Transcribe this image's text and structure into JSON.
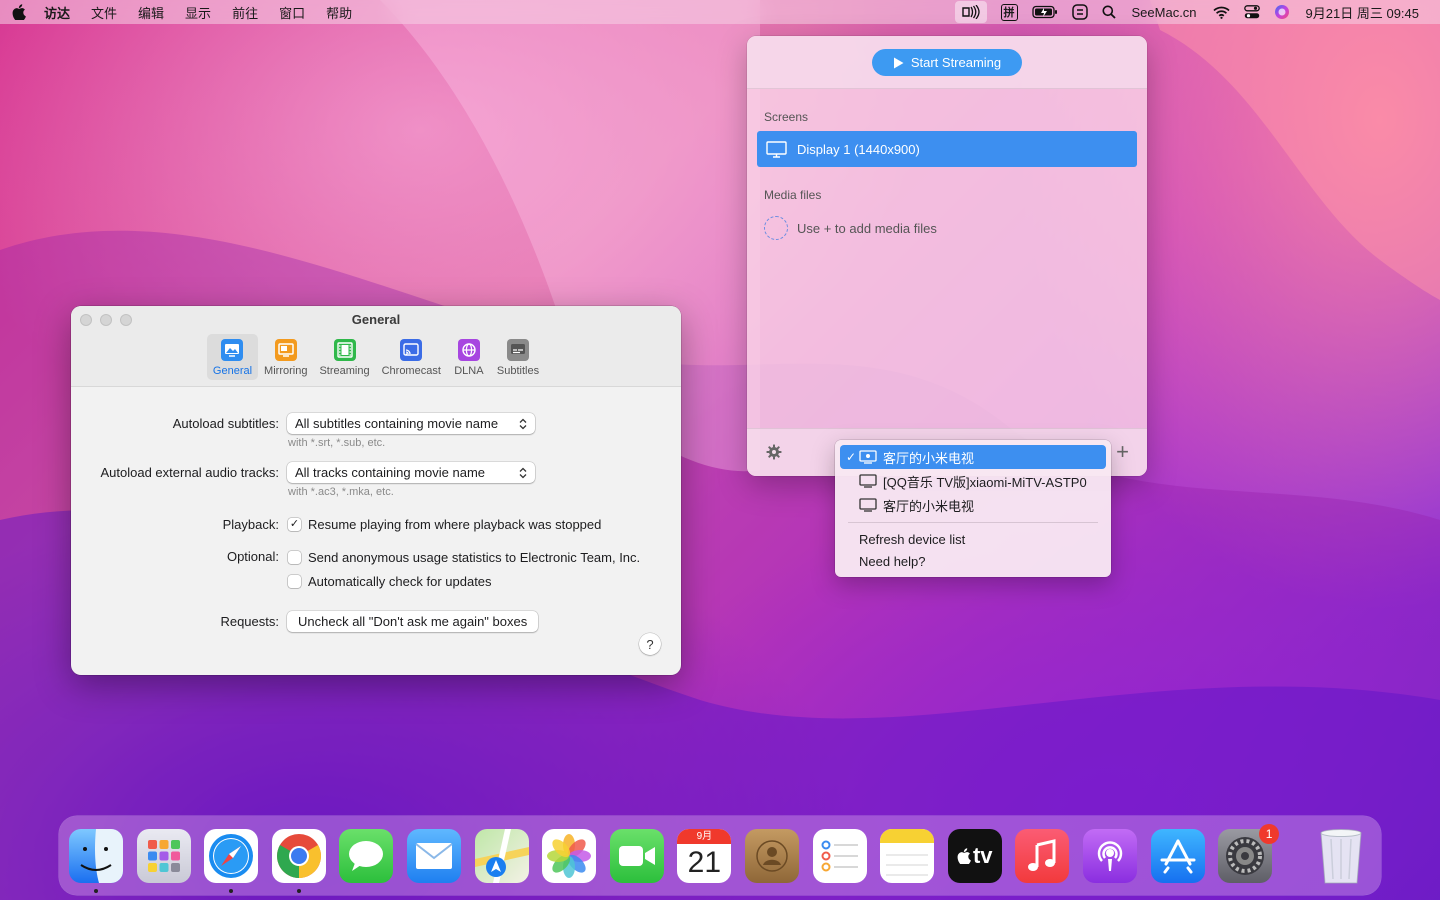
{
  "menubar": {
    "items": [
      "访达",
      "文件",
      "编辑",
      "显示",
      "前往",
      "窗口",
      "帮助"
    ],
    "site": "SeeMac.cn",
    "clock": "9月21日 周三  09:45",
    "input_method": "拼"
  },
  "prefs": {
    "title": "General",
    "tabs": [
      "General",
      "Mirroring",
      "Streaming",
      "Chromecast",
      "DLNA",
      "Subtitles"
    ],
    "autoload_subtitles_label": "Autoload subtitles:",
    "autoload_subtitles_value": "All subtitles containing movie name",
    "autoload_subtitles_hint": "with *.srt, *.sub, etc.",
    "autoload_audio_label": "Autoload external audio tracks:",
    "autoload_audio_value": "All tracks containing movie name",
    "autoload_audio_hint": "with *.ac3, *.mka, etc.",
    "playback_label": "Playback:",
    "playback_option": "Resume playing from where playback was stopped",
    "optional_label": "Optional:",
    "optional_stats": "Send anonymous usage statistics to Electronic Team, Inc.",
    "optional_updates": "Automatically check for updates",
    "requests_label": "Requests:",
    "requests_button": "Uncheck all \"Don't ask me again\" boxes",
    "help": "?"
  },
  "popover": {
    "start_button": "Start Streaming",
    "screens_label": "Screens",
    "display": "Display 1 (1440x900)",
    "media_label": "Media files",
    "media_hint": "Use + to add media files",
    "plus": "+"
  },
  "dropdown": {
    "check": "✓",
    "devices": [
      "客厅的小米电视",
      "[QQ音乐 TV版]xiaomi-MiTV-ASTP0",
      "客厅的小米电视"
    ],
    "refresh": "Refresh device list",
    "help": "Need help?"
  },
  "dock": {
    "calendar_month": "9月",
    "calendar_day": "21",
    "tv_label": "tv",
    "settings_badge": "1"
  }
}
